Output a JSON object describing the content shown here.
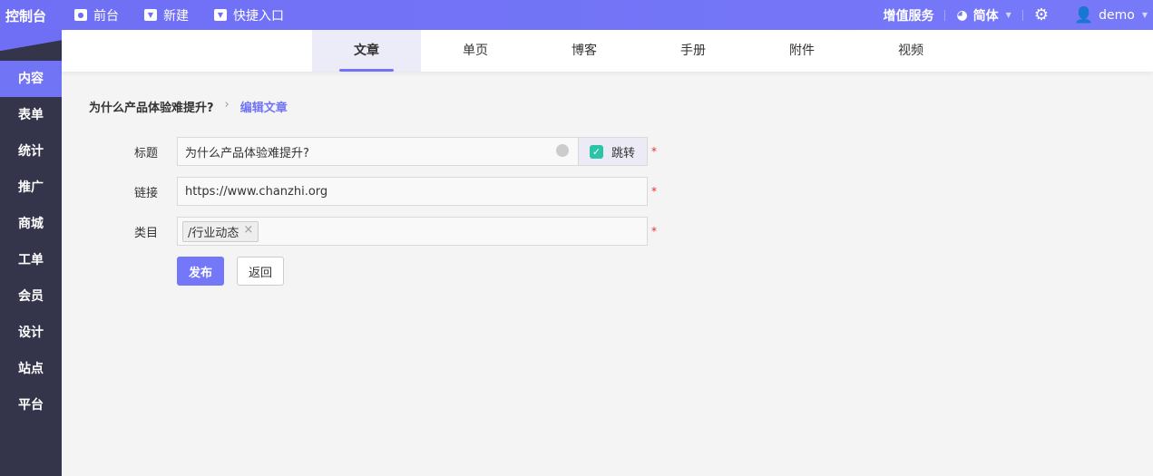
{
  "logo": "控制台",
  "topnav": [
    {
      "label": "前台",
      "icon": "eye-icon"
    },
    {
      "label": "新建",
      "icon": "caret-down-icon"
    },
    {
      "label": "快捷入口",
      "icon": "caret-down-icon"
    }
  ],
  "topright": {
    "vas": "增值服务",
    "lang": "简体",
    "user": "demo"
  },
  "sidebar": [
    "内容",
    "表单",
    "统计",
    "推广",
    "商城",
    "工单",
    "会员",
    "设计",
    "站点",
    "平台"
  ],
  "tabs": [
    "文章",
    "单页",
    "博客",
    "手册",
    "附件",
    "视频"
  ],
  "breadcrumb": {
    "parent": "为什么产品体验难提升?",
    "current": "编辑文章"
  },
  "form": {
    "title_label": "标题",
    "title_value": "为什么产品体验难提升?",
    "jump_label": "跳转",
    "jump_checked": true,
    "link_label": "链接",
    "link_value": "https://www.chanzhi.org",
    "category_label": "类目",
    "category_tag": "/行业动态",
    "tag_remove": "×",
    "required": "*"
  },
  "buttons": {
    "publish": "发布",
    "back": "返回"
  }
}
